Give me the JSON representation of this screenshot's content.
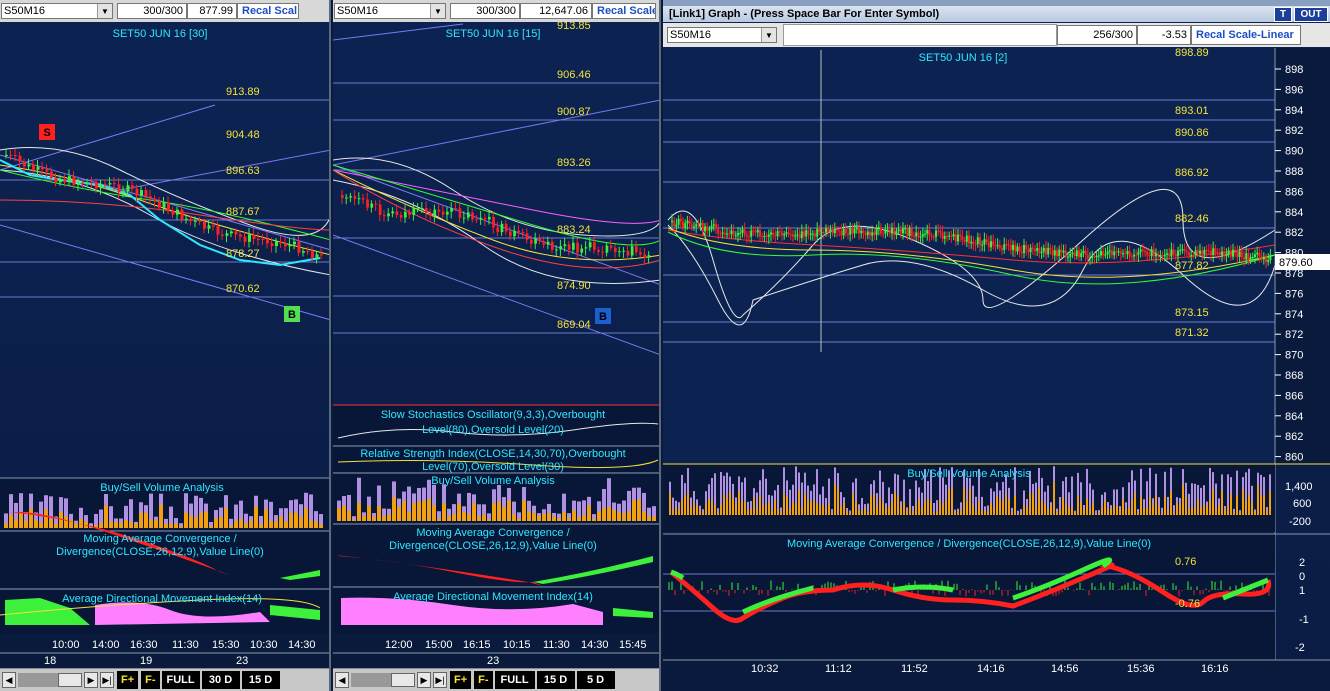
{
  "panel1": {
    "symbol": "S50M16",
    "bar_count": "300/300",
    "last_value": "877.99",
    "recal_label": "Recal Scal",
    "chart_title": "SET50 JUN 16  [30]",
    "levels": [
      "913.89",
      "904.48",
      "896.63",
      "887.67",
      "878.27",
      "870.62"
    ],
    "sell_marker": "S",
    "buy_marker": "B",
    "ind_volume": "Buy/Sell Volume Analysis",
    "ind_macd_1": "Moving Average Convergence /",
    "ind_macd_2": "Divergence(CLOSE,26,12,9),Value Line(0)",
    "ind_adx": "Average Directional Movement Index(14)",
    "time_labels": [
      "10:00",
      "14:00",
      "16:30",
      "11:30",
      "15:30",
      "10:30",
      "14:30"
    ],
    "date_labels": [
      "18",
      "19",
      "23"
    ],
    "btn_full": "FULL",
    "btn_30d": "30 D",
    "btn_15d": "15 D"
  },
  "panel2": {
    "symbol": "S50M16",
    "bar_count": "300/300",
    "last_value": "12,647.06",
    "recal_label": "Recal Scale",
    "chart_title": "SET50 JUN 16  [15]",
    "top_level": "913.85",
    "levels": [
      "906.46",
      "900.87",
      "893.26",
      "883.24",
      "874.90",
      "869.04"
    ],
    "buy_marker": "B",
    "ind_stoch_1": "Slow Stochastics Oscillator(9,3,3),Overbought",
    "ind_stoch_2": "Level(80),Oversold Level(20)",
    "ind_rsi_1": "Relative Strength Index(CLOSE,14,30,70),Overbought",
    "ind_rsi_2": "Level(70),Oversold Level(30)",
    "ind_volume": "Buy/Sell Volume Analysis",
    "ind_macd_1": "Moving Average Convergence /",
    "ind_macd_2": "Divergence(CLOSE,26,12,9),Value Line(0)",
    "ind_adx": "Average Directional Movement Index(14)",
    "time_labels": [
      "12:00",
      "15:00",
      "16:15",
      "10:15",
      "11:30",
      "14:30",
      "15:45"
    ],
    "date_labels": [
      "23"
    ],
    "btn_full": "FULL",
    "btn_15d": "15 D",
    "btn_5d": "5 D"
  },
  "panel3": {
    "window_title": "[Link1] Graph  - (Press Space Bar For Enter Symbol)",
    "btn_t": "T",
    "btn_out": "OUT",
    "symbol": "S50M16",
    "bar_count": "256/300",
    "last_value": "-3.53",
    "recal_label": "Recal Scale-Linear",
    "chart_title": "SET50 JUN 16  [2]",
    "levels": [
      "898.89",
      "893.01",
      "890.86",
      "886.92",
      "882.46",
      "877.82",
      "873.15",
      "871.32"
    ],
    "current_price": "879.60",
    "y_ticks": [
      "898",
      "896",
      "894",
      "892",
      "890",
      "888",
      "886",
      "884",
      "882",
      "880",
      "878",
      "876",
      "874",
      "872",
      "870",
      "868",
      "866",
      "864",
      "862",
      "860"
    ],
    "ind_volume": "Buy/Sell Volume Analysis",
    "vol_ticks": [
      "1,400",
      "600",
      "-200"
    ],
    "ind_macd": "Moving Average Convergence / Divergence(CLOSE,26,12,9),Value Line(0)",
    "macd_upper": "0.76",
    "macd_lower": "-0.76",
    "macd_ticks": [
      "2",
      "1",
      "0",
      "-1",
      "-2"
    ],
    "time_labels": [
      "10:32",
      "11:12",
      "11:52",
      "14:16",
      "14:56",
      "15:36",
      "16:16"
    ]
  },
  "colors": {
    "background": "#0b2150",
    "level_text": "#f5e23a",
    "title_text": "#2ee8ff",
    "bull": "#3cf03c",
    "bear": "#ff2020",
    "volume_buy": "#f0a010",
    "volume_sell": "#b090e0",
    "adx_fill": "#ff80ff"
  }
}
